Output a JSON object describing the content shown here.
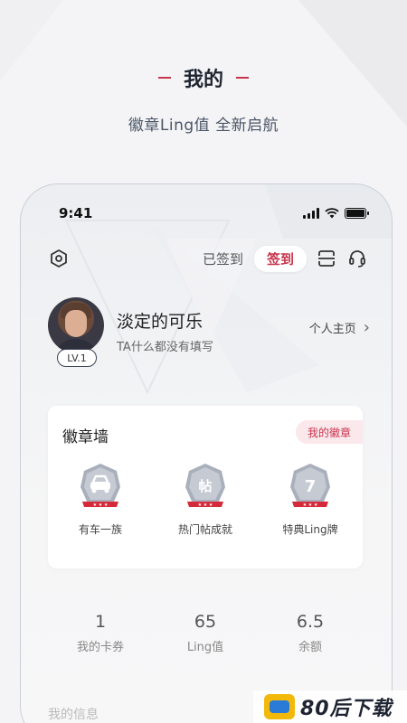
{
  "promo": {
    "title": "我的",
    "subtitle": "徽章Ling值  全新启航"
  },
  "status_bar": {
    "time": "9:41"
  },
  "topbar": {
    "signed_text": "已签到",
    "checkin_label": "签到",
    "icons": [
      "settings-icon",
      "scan-icon",
      "headset-icon"
    ]
  },
  "profile": {
    "nickname": "淡定的可乐",
    "bio": "TA什么都没有填写",
    "level": "LV.1",
    "homepage_label": "个人主页",
    "chevron": "›"
  },
  "badge_wall": {
    "title": "徽章墙",
    "my_badges_label": "我的徽章",
    "badges": [
      {
        "name": "有车一族",
        "icon": "car-badge-icon"
      },
      {
        "name": "热门帖成就",
        "icon": "post-badge-icon",
        "glyph": "帖"
      },
      {
        "name": "特典Ling牌",
        "icon": "seven-badge-icon",
        "glyph": "7"
      }
    ]
  },
  "stats": [
    {
      "value": "1",
      "label": "我的卡券"
    },
    {
      "value": "65",
      "label": "Ling值"
    },
    {
      "value": "6.5",
      "label": "余额"
    }
  ],
  "section_my_info": "我的信息",
  "watermark": {
    "text": "80后下载"
  },
  "colors": {
    "accent": "#c8344c",
    "accent_light": "#fbe8ec",
    "badge_ribbon": "#d42a3a",
    "badge_grey": "#9aa3b2"
  }
}
